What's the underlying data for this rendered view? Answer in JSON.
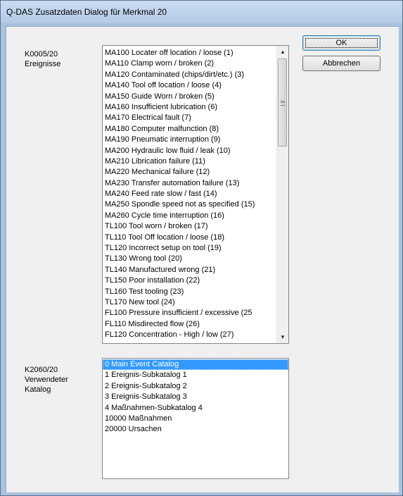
{
  "window": {
    "title": "Q-DAS Zusatzdaten Dialog für Merkmal 20"
  },
  "buttons": {
    "ok": "OK",
    "cancel": "Abbrechen"
  },
  "events": {
    "label_line1": "K0005/20",
    "label_line2": "Ereignisse",
    "items": [
      "MA100  Locater off location / loose  (1)",
      "MA110  Clamp worn / broken  (2)",
      "MA120  Contaminated (chips/dirt/etc.)  (3)",
      "MA140  Tool off location / loose  (4)",
      "MA150  Guide Worn / broken  (5)",
      "MA160  Insufficient lubrication  (6)",
      "MA170  Electrical fault  (7)",
      "MA180  Computer malfunction  (8)",
      "MA190  Pneumatic interruption  (9)",
      "MA200  Hydraulic low fluid / leak  (10)",
      "MA210  Librication failure  (11)",
      "MA220  Mechanical failure  (12)",
      "MA230  Transfer automation failure  (13)",
      "MA240  Feed rate slow / fast  (14)",
      "MA250  Spondle speed not as specified  (15)",
      "MA260  Cycle time interruption  (16)",
      "TL100  Tool worn / broken  (17)",
      "TL110  Tool Off location / loose  (18)",
      "TL120  Incorrect setup on tool  (19)",
      "TL130  Wrong tool  (20)",
      "TL140  Manufactured wrong  (21)",
      "TL150  Poor installation  (22)",
      "TL160  Test tooling  (23)",
      "TL170  New tool  (24)",
      "FL100  Pressure insufficient / excessive  (25",
      "FL110  Misdirected flow  (26)",
      "FL120  Concentration - High / low  (27)"
    ]
  },
  "catalog": {
    "label_line1": "K2060/20",
    "label_line2": "Verwendeter",
    "label_line3": "Katalog",
    "items": [
      "0  Main Event Catalog",
      "1  Ereignis-Subkatalog 1",
      "2  Ereignis-Subkatalog 2",
      "3  Ereignis-Subkatalog 3",
      "4  Maßnahmen-Subkatalog 4",
      "10000  Maßnahmen",
      "20000  Ursachen"
    ],
    "selected_index": 0
  },
  "icons": {
    "scroll_up": "scroll-up-arrow-icon",
    "scroll_down": "scroll-down-arrow-icon",
    "grip": "scroll-grip-icon"
  }
}
